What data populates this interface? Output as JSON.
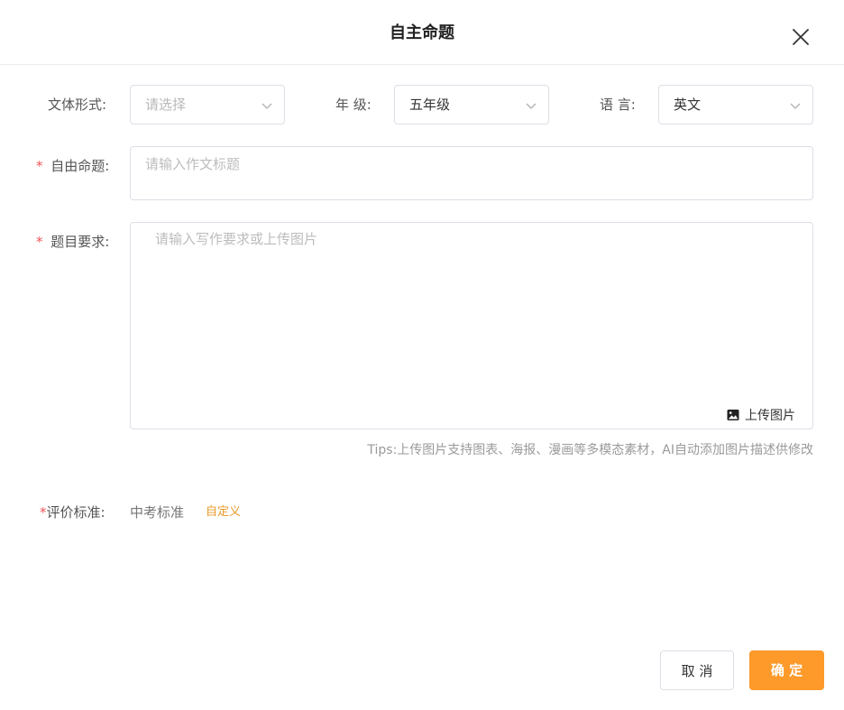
{
  "dialog": {
    "title": "自主命题"
  },
  "form": {
    "style": {
      "label": "文体形式:",
      "placeholder": "请选择",
      "value": ""
    },
    "grade": {
      "label": "年 级:",
      "value": "五年级"
    },
    "language": {
      "label": "语 言:",
      "value": "英文"
    },
    "topic": {
      "required_mark": "*",
      "label": "自由命题:",
      "placeholder": "请输入作文标题",
      "value": ""
    },
    "requirements": {
      "required_mark": "*",
      "label": "题目要求:",
      "placeholder": "请输入写作要求或上传图片",
      "value": "",
      "upload_label": "上传图片",
      "tips": "Tips:上传图片支持图表、海报、漫画等多模态素材，AI自动添加图片描述供修改"
    },
    "criteria": {
      "required_mark": "*",
      "label": "评价标准:",
      "value": "中考标准",
      "custom_link": "自定义"
    }
  },
  "footer": {
    "cancel_label": "取 消",
    "confirm_label": "确 定"
  },
  "colors": {
    "accent": "#fd9a2a",
    "link": "#e89a2a",
    "required": "#f0555a"
  },
  "icons": {
    "close": "close-icon",
    "chevron": "chevron-down-icon",
    "image": "image-icon"
  }
}
